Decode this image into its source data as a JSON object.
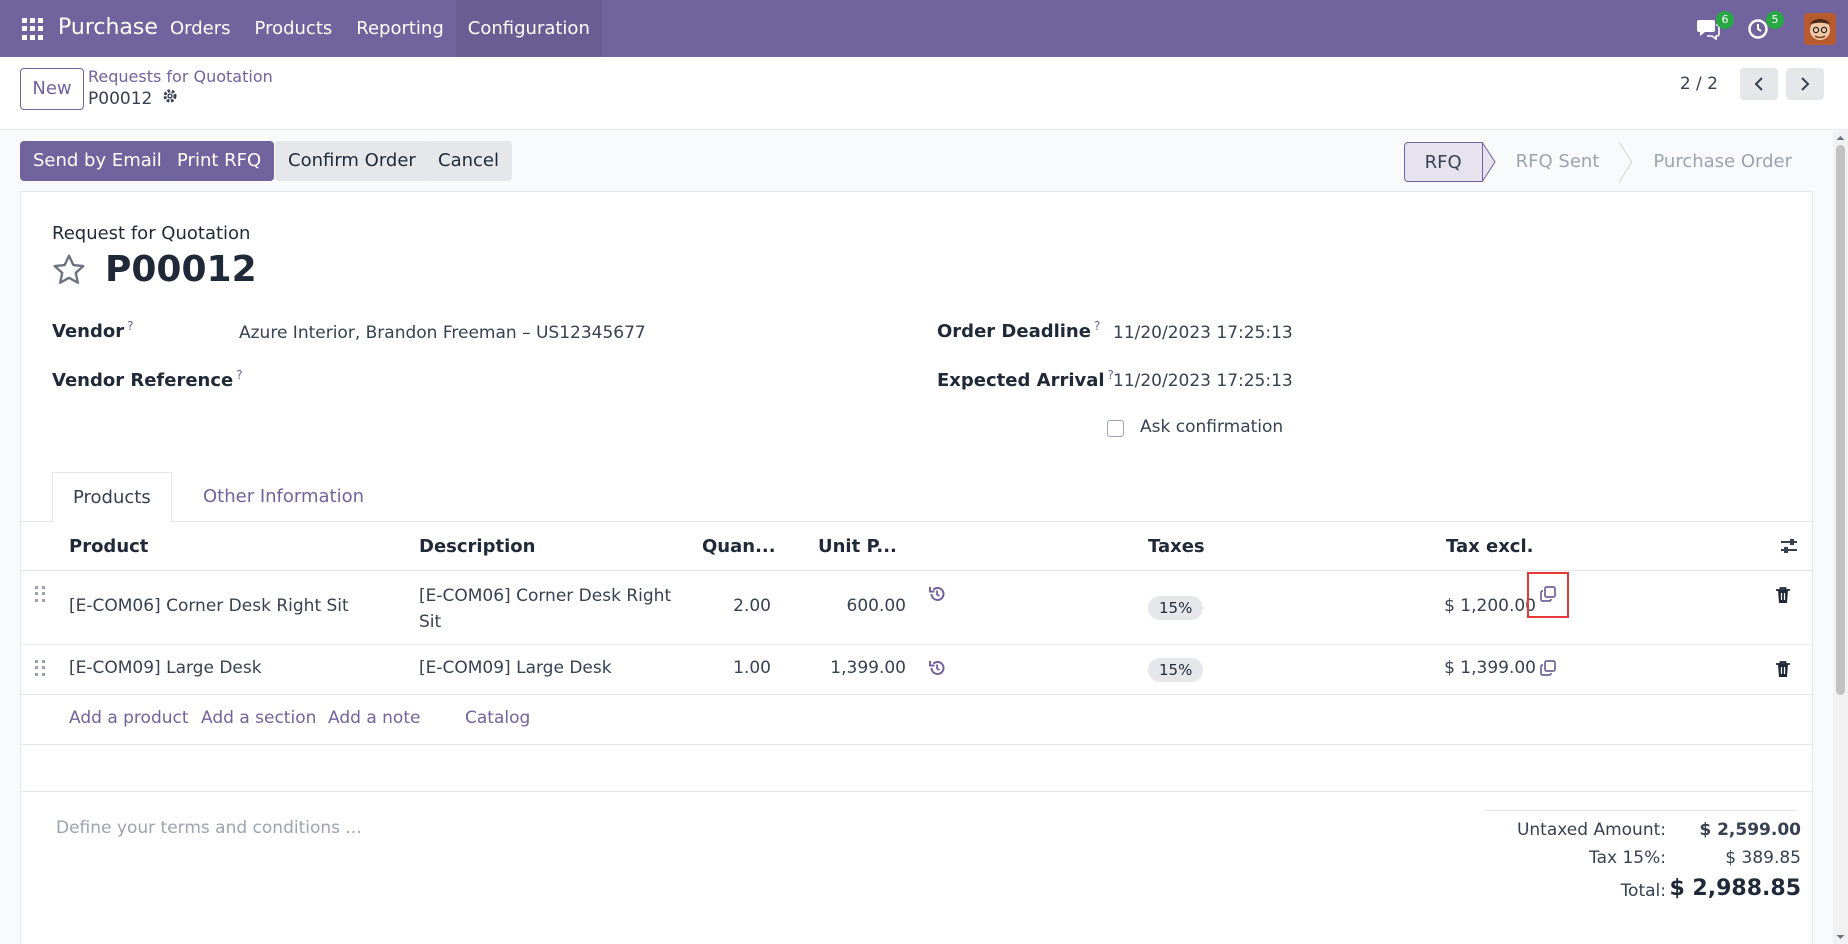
{
  "navbar": {
    "app_name": "Purchase",
    "menu": [
      "Orders",
      "Products",
      "Reporting",
      "Configuration"
    ],
    "messages_count": "6",
    "activities_count": "5",
    "bg_color": "#71639e"
  },
  "control_panel": {
    "new_label": "New",
    "breadcrumb": "Requests for Quotation",
    "record_name": "P00012",
    "pager_value": "2 / 2"
  },
  "actions": {
    "send_email": "Send by Email",
    "print_rfq": "Print RFQ",
    "confirm_order": "Confirm Order",
    "cancel": "Cancel"
  },
  "status": {
    "steps": [
      "RFQ",
      "RFQ Sent",
      "Purchase Order"
    ],
    "active": "RFQ"
  },
  "form": {
    "subtitle": "Request for Quotation",
    "title": "P00012",
    "vendor_label": "Vendor",
    "vendor_value": "Azure Interior, Brandon Freeman – US12345677",
    "vendor_ref_label": "Vendor Reference",
    "order_deadline_label": "Order Deadline",
    "order_deadline_value": "11/20/2023 17:25:13",
    "expected_arrival_label": "Expected Arrival",
    "expected_arrival_value": "11/20/2023 17:25:13",
    "ask_confirmation_label": "Ask confirmation",
    "help_mark": "?"
  },
  "tabs": [
    "Products",
    "Other Information"
  ],
  "table": {
    "headers": [
      "Product",
      "Description",
      "Quan...",
      "Unit P...",
      "Taxes",
      "Tax excl."
    ],
    "rows": [
      {
        "product": "[E-COM06] Corner Desk Right Sit",
        "description_1": "[E-COM06] Corner Desk Right",
        "description_2": "Sit",
        "quantity": "2.00",
        "unit_price": "600.00",
        "taxes": "15%",
        "subtotal": "$ 1,200.00"
      },
      {
        "product": "[E-COM09] Large Desk",
        "description_1": "[E-COM09] Large Desk",
        "description_2": "",
        "quantity": "1.00",
        "unit_price": "1,399.00",
        "taxes": "15%",
        "subtotal": "$ 1,399.00"
      }
    ],
    "add_links": [
      "Add a product",
      "Add a section",
      "Add a note",
      "Catalog"
    ]
  },
  "notes": {
    "placeholder": "Define your terms and conditions ..."
  },
  "totals": {
    "untaxed_label": "Untaxed Amount:",
    "untaxed_value": "$ 2,599.00",
    "tax_label": "Tax 15%:",
    "tax_value": "$ 389.85",
    "total_label": "Total:",
    "total_value": "$ 2,988.85"
  }
}
